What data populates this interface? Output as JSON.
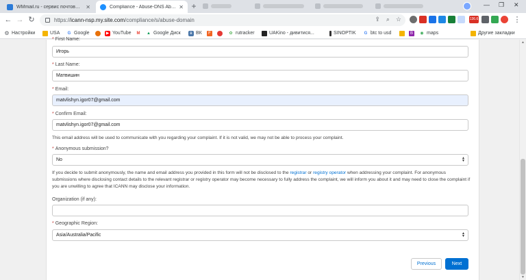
{
  "browser": {
    "tabs": [
      {
        "title": "WMmail.ru - сервис почтовых ре",
        "active": false,
        "favicon_color": "#2b7bd8"
      },
      {
        "title": "Compliance - Abuse-DNS Abuse (",
        "active": true,
        "favicon_color": "#1e90ff"
      }
    ],
    "address": {
      "url_prefix": "https://",
      "url_host": "icann-nsp.my.site.com",
      "url_path": "/compliance/s/abuse-domain"
    },
    "extension_badge": "136.6",
    "bookmarks": [
      {
        "label": "Настройки",
        "icon": "gear-icon"
      },
      {
        "label": "USA",
        "icon": "folder-icon"
      },
      {
        "label": "Google",
        "icon": "google-icon"
      },
      {
        "label": "",
        "icon": "badge-icon"
      },
      {
        "label": "YouTube",
        "icon": "youtube-icon"
      },
      {
        "label": "",
        "icon": "gmail-icon"
      },
      {
        "label": "Google Диск",
        "icon": "drive-icon"
      },
      {
        "label": "ВК",
        "icon": "vk-icon"
      },
      {
        "label": "",
        "icon": "f-icon"
      },
      {
        "label": "",
        "icon": "red-icon"
      },
      {
        "label": "rutracker",
        "icon": "rutracker-icon"
      },
      {
        "label": "UAKino - дивитися...",
        "icon": "uakino-icon"
      },
      {
        "label": "SINOPTIK",
        "icon": "sinoptik-icon"
      },
      {
        "label": "btc to usd",
        "icon": "google-icon"
      },
      {
        "label": "",
        "icon": "folder-icon"
      },
      {
        "label": "",
        "icon": "bc-icon"
      },
      {
        "label": "maps",
        "icon": "maps-icon"
      }
    ],
    "other_bookmarks": "Другие закладки"
  },
  "form": {
    "first_name": {
      "label": "First Name:",
      "value": "Игорь"
    },
    "last_name": {
      "label": "Last Name:",
      "value": "Матвишин"
    },
    "email": {
      "label": "Email:",
      "value": "matvlishyn.igor07@gmail.com"
    },
    "confirm_email": {
      "label": "Confirm Email:",
      "value": "matvlishyn.igor07@gmail.com"
    },
    "email_note": "This email address will be used to communicate with you regarding your complaint. If it is not valid, we may not be able to process your complaint.",
    "anonymous": {
      "label": "Anonymous submission?",
      "value": "No"
    },
    "anon_note_1": "If you decide to submit anonymously, the name and email address you provided in this form will not be disclosed to the",
    "anon_link_registrar": "registrar",
    "anon_or": "or",
    "anon_link_operator": "registry operator",
    "anon_note_2": "when addressing your complaint. For anonymous submissions where disclosing contact details to the relevant registrar or registry operator may become necessary to fully address the complaint, we will inform you about it and may need to close the complaint if you are unwilling to agree that ICANN may disclose your information.",
    "organization": {
      "label": "Organization (if any):",
      "value": ""
    },
    "region": {
      "label": "Geographic Region:",
      "value": "Asia/Australia/Pacific"
    },
    "required_mark": "*",
    "buttons": {
      "previous": "Previous",
      "next": "Next"
    }
  }
}
